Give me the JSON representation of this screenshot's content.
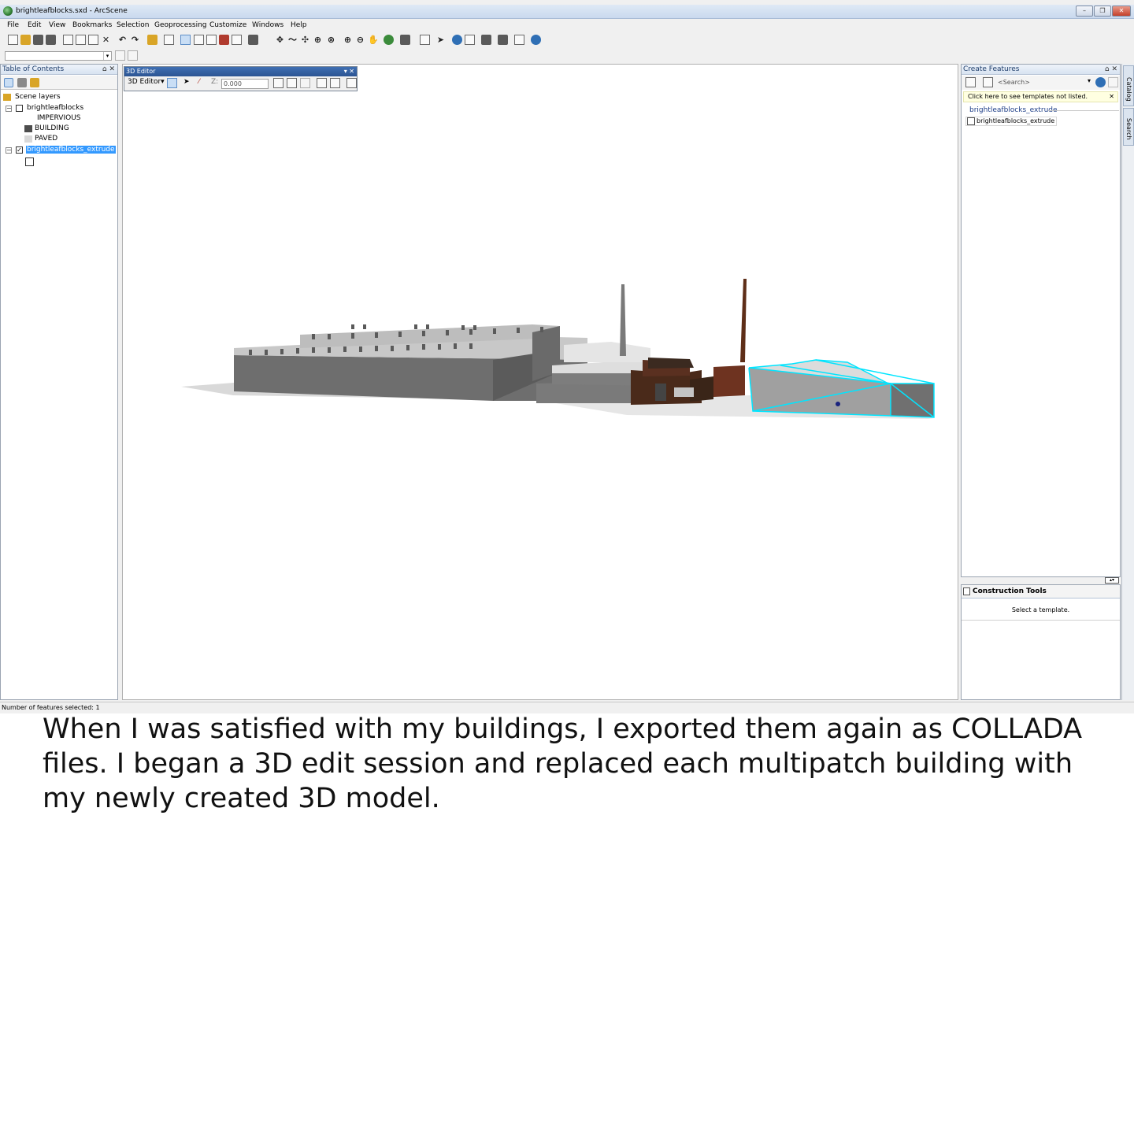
{
  "window": {
    "title": "brightleafblocks.sxd - ArcScene",
    "buttons": {
      "minimize": "–",
      "restore": "❐",
      "close": "✕"
    }
  },
  "menu": [
    "File",
    "Edit",
    "View",
    "Bookmarks",
    "Selection",
    "Geoprocessing",
    "Customize",
    "Windows",
    "Help"
  ],
  "toc": {
    "title": "Table of Contents",
    "controls": "⌂ ✕",
    "root": "Scene layers",
    "layers": [
      {
        "name": "brightleafblocks",
        "checked": false,
        "legend": [
          {
            "label": "IMPERVIOUS",
            "color": "#ffffff"
          },
          {
            "label": "BUILDING",
            "color": "#4d4d4d"
          },
          {
            "label": "PAVED",
            "color": "#d9d9d9"
          }
        ]
      },
      {
        "name": "brightleafblocks_extrude",
        "checked": true,
        "selected": true
      }
    ],
    "expander": "−",
    "check_mark": "✓"
  },
  "editor": {
    "title": "3D Editor",
    "menu_label": "3D Editor▾",
    "z_label": "Z:",
    "z_value": "0.000",
    "controls": "▾ ✕"
  },
  "create_features": {
    "title": "Create Features",
    "controls": "⌂ ✕",
    "search_placeholder": "<Search>",
    "hint": "Click here to see templates not listed.",
    "hint_close": "✕",
    "group": "brightleafblocks_extrude",
    "template": "brightleafblocks_extrude"
  },
  "construction_tools": {
    "title": "Construction Tools",
    "message": "Select a template."
  },
  "side_tabs": [
    "Catalog",
    "Search"
  ],
  "status": "Number of features selected: 1",
  "caption": "When I was satisfied with my buildings, I exported them again as COLLADA files. I began a 3D edit session and replaced each multipatch building with my newly created 3D model.",
  "colors": {
    "selection": "#00e5ff",
    "building_gray": "#6b6b6b",
    "brick": "#5a2e1c"
  }
}
